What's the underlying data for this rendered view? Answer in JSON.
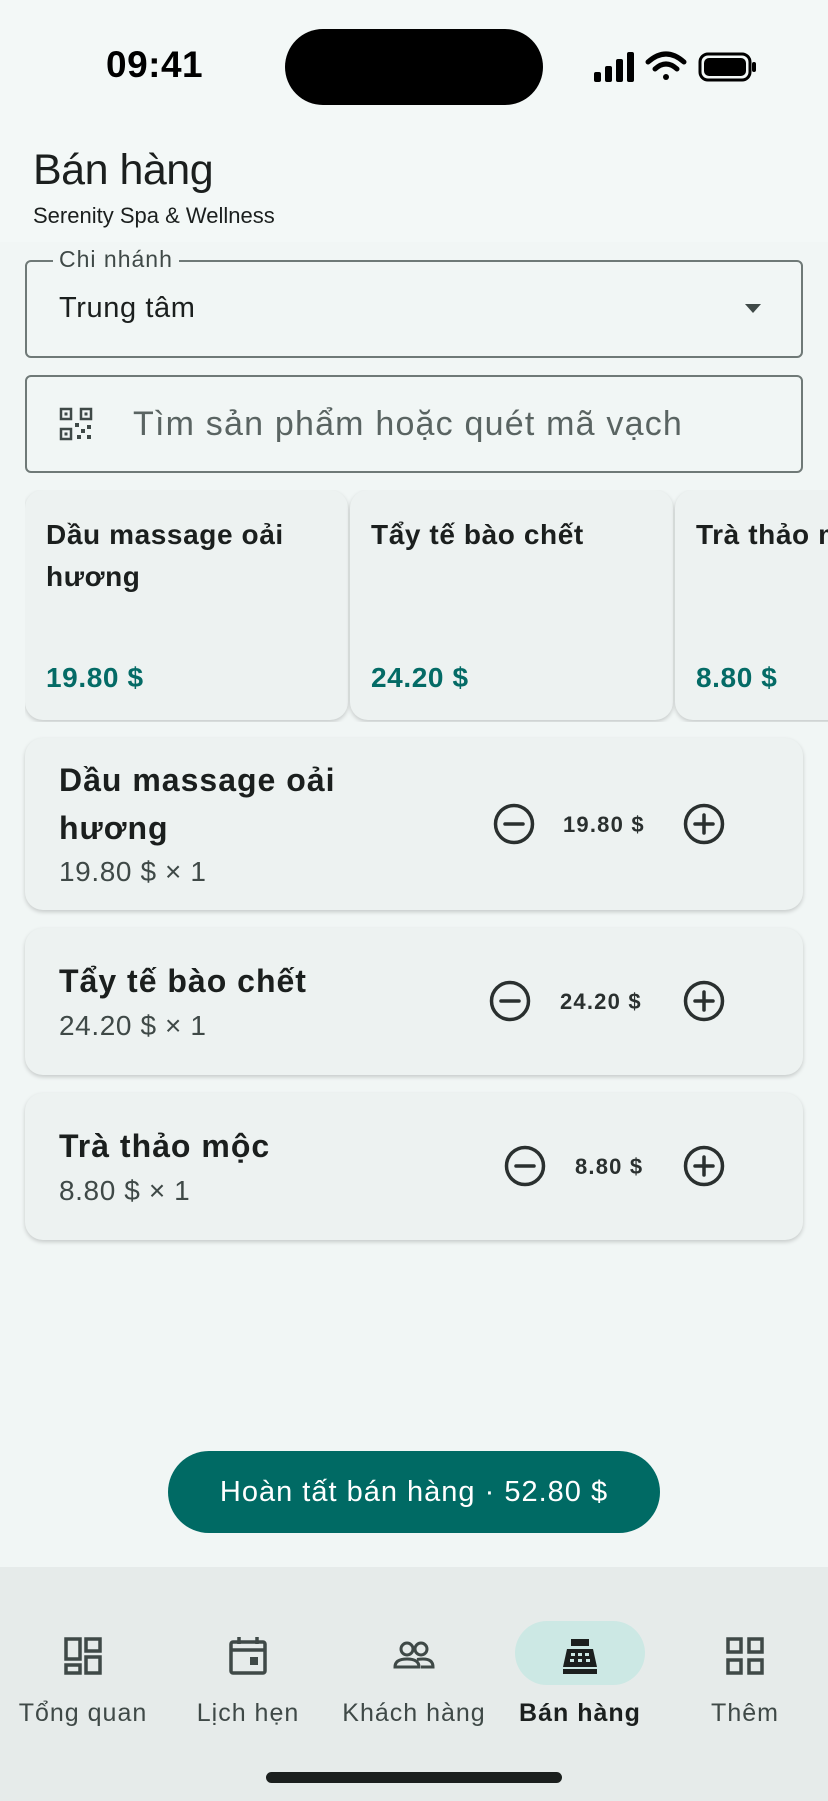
{
  "status_bar": {
    "time": "09:41"
  },
  "header": {
    "title": "Bán hàng",
    "subtitle": "Serenity Spa & Wellness"
  },
  "branch": {
    "label": "Chi nhánh",
    "value": "Trung tâm"
  },
  "search": {
    "placeholder": "Tìm sản phẩm hoặc quét mã vạch"
  },
  "products": [
    {
      "name": "Dầu massage oải hương",
      "price": "19.80 $"
    },
    {
      "name": "Tẩy tế bào chết",
      "price": "24.20 $"
    },
    {
      "name": "Trà thảo mộc",
      "price": "8.80 $"
    }
  ],
  "cart": [
    {
      "name": "Dầu massage oải hương",
      "detail": "19.80 $ × 1",
      "total": "19.80 $"
    },
    {
      "name": "Tẩy tế bào chết",
      "detail": "24.20 $ × 1",
      "total": "24.20 $"
    },
    {
      "name": "Trà thảo mộc",
      "detail": "8.80 $ × 1",
      "total": "8.80 $"
    }
  ],
  "checkout": {
    "label": "Hoàn tất bán hàng · 52.80 $"
  },
  "nav": [
    {
      "label": "Tổng quan",
      "icon": "dashboard-icon"
    },
    {
      "label": "Lịch hẹn",
      "icon": "calendar-icon"
    },
    {
      "label": "Khách hàng",
      "icon": "people-icon"
    },
    {
      "label": "Bán hàng",
      "icon": "cash-register-icon",
      "active": true
    },
    {
      "label": "Thêm",
      "icon": "grid-icon"
    }
  ],
  "colors": {
    "primary": "#006a64",
    "price": "#046b66",
    "active_nav": "#cce8e4",
    "background": "#f3f8f7"
  }
}
